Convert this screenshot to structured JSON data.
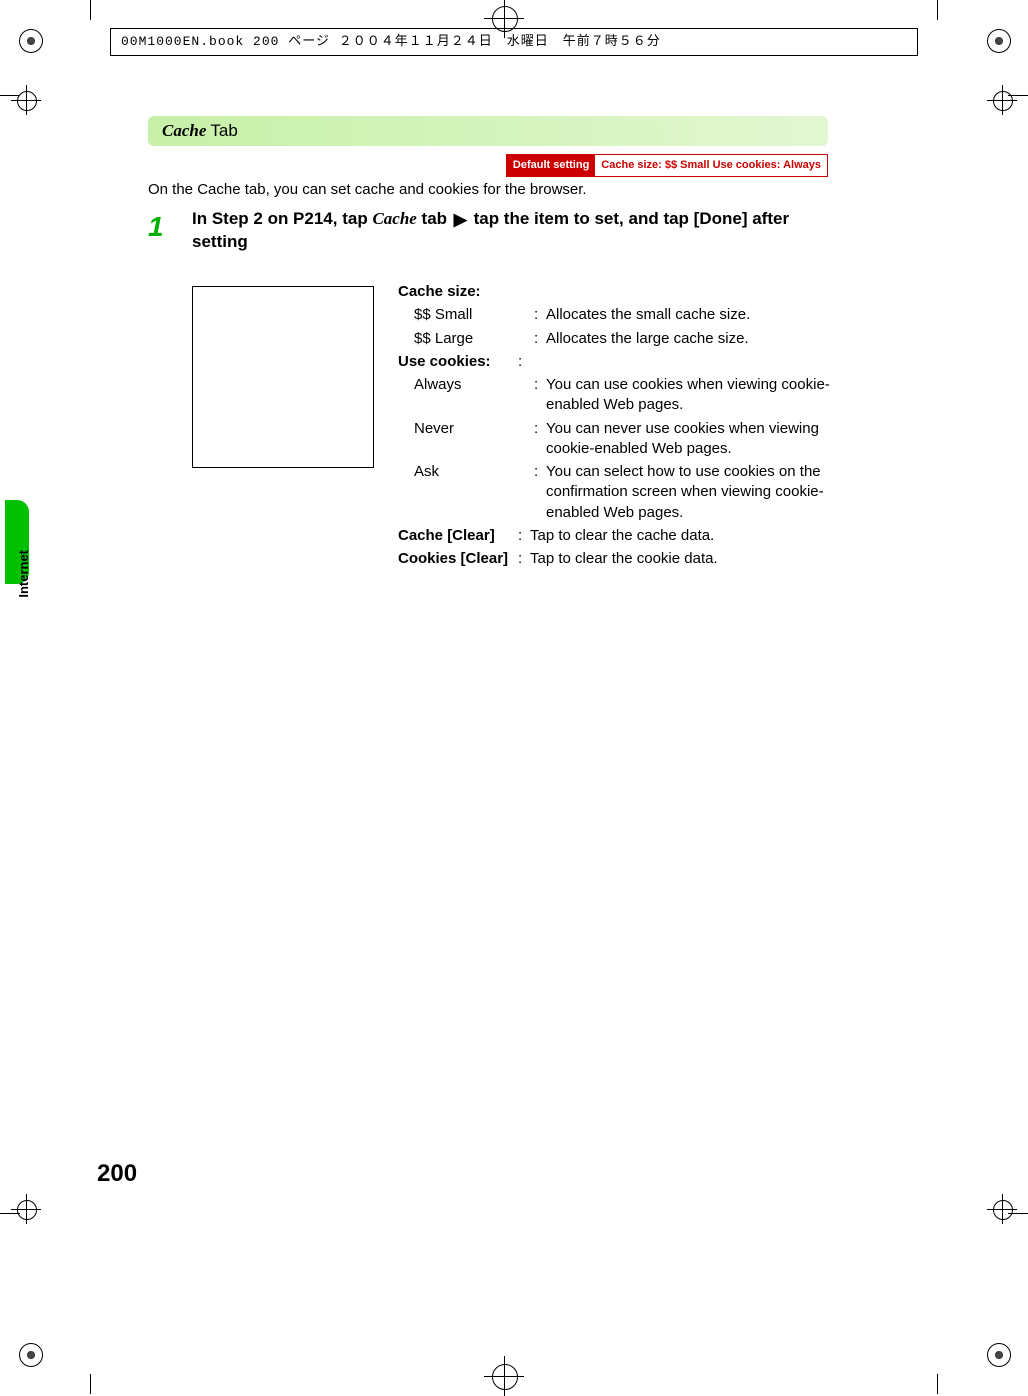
{
  "print_header": "00M1000EN.book  200 ページ  ２００４年１１月２４日　水曜日　午前７時５６分",
  "section": {
    "title_italic": "Cache",
    "title_rest": " Tab"
  },
  "default_setting": {
    "label": "Default setting",
    "value": "Cache size: $$ Small Use cookies: Always"
  },
  "intro": "On the Cache tab, you can set cache and cookies for the browser.",
  "step": {
    "number": "1",
    "pre": "In Step 2 on P214, tap ",
    "tab_name": "Cache",
    "post_tab": " tab ",
    "arrow": "▶",
    "rest": " tap the item to set, and tap [Done] after setting"
  },
  "defs": [
    {
      "term": "Cache size:",
      "strong": true,
      "colon": "",
      "desc": ""
    },
    {
      "term": "$$ Small",
      "sub": true,
      "colon": ":",
      "desc": "Allocates the small cache size."
    },
    {
      "term": "$$ Large",
      "sub": true,
      "colon": ":",
      "desc": "Allocates the large cache size."
    },
    {
      "term": "Use cookies:",
      "strong": true,
      "colon": ":",
      "desc": ""
    },
    {
      "term": "Always",
      "sub": true,
      "colon": ":",
      "desc": "You can use cookies when viewing cookie-enabled Web pages."
    },
    {
      "term": "Never",
      "sub": true,
      "colon": ":",
      "desc": "You can never use cookies when viewing cookie-enabled Web pages."
    },
    {
      "term": "Ask",
      "sub": true,
      "colon": ":",
      "desc": "You can select how to use cookies on the confirmation screen when viewing cookie-enabled Web pages."
    },
    {
      "term": "Cache [Clear]",
      "strong": true,
      "colon": ":",
      "desc": "Tap to clear the cache data."
    },
    {
      "term": "Cookies [Clear]",
      "strong": true,
      "colon": ":",
      "desc": "Tap to clear the cookie data."
    }
  ],
  "side_tab": "Internet",
  "page_number": "200"
}
